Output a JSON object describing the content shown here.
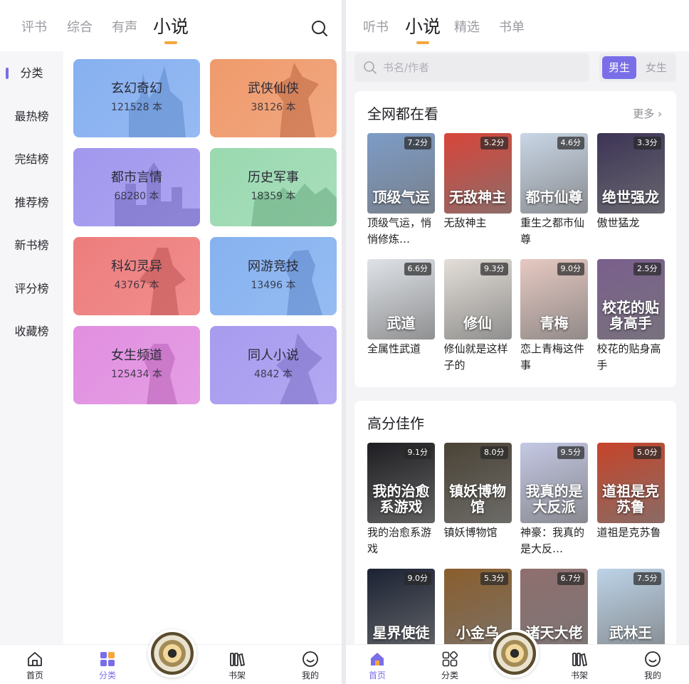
{
  "left": {
    "tabs": [
      "评书",
      "综合",
      "有声",
      "小说"
    ],
    "side_items": [
      "分类",
      "最热榜",
      "完结榜",
      "推荐榜",
      "新书榜",
      "评分榜",
      "收藏榜"
    ],
    "categories": [
      {
        "name": "玄幻奇幻",
        "count": "121528 本",
        "color": "#86b0f0"
      },
      {
        "name": "武侠仙侠",
        "count": "38126 本",
        "color": "#ef9a6c"
      },
      {
        "name": "都市言情",
        "count": "68280 本",
        "color": "#a197ee"
      },
      {
        "name": "历史军事",
        "count": "18359 本",
        "color": "#9ad9b0"
      },
      {
        "name": "科幻灵异",
        "count": "43767 本",
        "color": "#ee7d7d"
      },
      {
        "name": "网游竞技",
        "count": "13496 本",
        "color": "#86b2f0"
      },
      {
        "name": "女生频道",
        "count": "125434 本",
        "color": "#e18fe0"
      },
      {
        "name": "同人小说",
        "count": "4842 本",
        "color": "#a79bef"
      }
    ],
    "nav": [
      "首页",
      "分类",
      "书架",
      "我的"
    ]
  },
  "right": {
    "tabs": [
      "听书",
      "小说",
      "精选",
      "书单"
    ],
    "search_placeholder": "书名/作者",
    "gender": [
      "男生",
      "女生"
    ],
    "section1": {
      "title": "全网都在看",
      "more": "更多 ›",
      "books": [
        {
          "name": "顶级气运，悄悄修炼…",
          "score": "7.2分",
          "cover_text": "顶级气运",
          "bg": "#7d9cc8"
        },
        {
          "name": "无敌神主",
          "score": "5.2分",
          "cover_text": "无敌神主",
          "bg": "#d8453a"
        },
        {
          "name": "重生之都市仙尊",
          "score": "4.6分",
          "cover_text": "都市仙尊",
          "bg": "#c9d6e6"
        },
        {
          "name": "傲世猛龙",
          "score": "3.3分",
          "cover_text": "绝世强龙",
          "bg": "#3d3456"
        },
        {
          "name": "全属性武道",
          "score": "6.6分",
          "cover_text": "武道",
          "bg": "#dfe3e8"
        },
        {
          "name": "修仙就是这样子的",
          "score": "9.3分",
          "cover_text": "修仙",
          "bg": "#e3ded8"
        },
        {
          "name": "恋上青梅这件事",
          "score": "9.0分",
          "cover_text": "青梅",
          "bg": "#e7c9c2"
        },
        {
          "name": "校花的贴身高手",
          "score": "2.5分",
          "cover_text": "校花的贴身高手",
          "bg": "#7a5f8e"
        }
      ]
    },
    "section2": {
      "title": "高分佳作",
      "books": [
        {
          "name": "我的治愈系游戏",
          "score": "9.1分",
          "cover_text": "我的治愈系游戏",
          "bg": "#1e1e22"
        },
        {
          "name": "镇妖博物馆",
          "score": "8.0分",
          "cover_text": "镇妖博物馆",
          "bg": "#4a4336"
        },
        {
          "name": "神豪：我真的是大反…",
          "score": "9.5分",
          "cover_text": "我真的是大反派",
          "bg": "#c4c8e4"
        },
        {
          "name": "道祖是克苏鲁",
          "score": "5.0分",
          "cover_text": "道祖是克苏鲁",
          "bg": "#c6442a"
        },
        {
          "name": "",
          "score": "9.0分",
          "cover_text": "星界使徒",
          "bg": "#1b2233"
        },
        {
          "name": "",
          "score": "5.3分",
          "cover_text": "小金乌",
          "bg": "#8a5e2d"
        },
        {
          "name": "",
          "score": "6.7分",
          "cover_text": "诸天大佬",
          "bg": "#8f6f6e"
        },
        {
          "name": "",
          "score": "7.5分",
          "cover_text": "武林王",
          "bg": "#bcd3e8"
        }
      ]
    },
    "nav": [
      "首页",
      "分类",
      "书架",
      "我的"
    ]
  },
  "colors": {
    "accent": "#7a6ee8",
    "tab_underline": "#f4a73b"
  }
}
